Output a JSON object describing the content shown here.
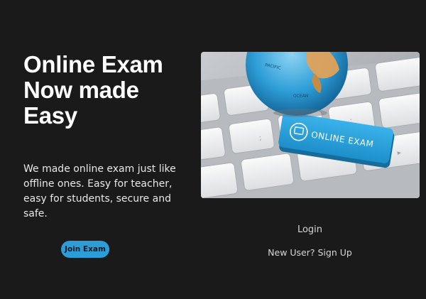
{
  "hero": {
    "title": "Online Exam Now made Easy",
    "description": "We made online exam just like offline ones. Easy for teacher, easy for students, secure and safe.",
    "join_button_label": "Join Exam"
  },
  "image": {
    "key_label": "ONLINE EXAM",
    "globe_text_1": "PACIFIC",
    "globe_text_2": "OCEAN"
  },
  "auth": {
    "login_label": "Login",
    "signup_label": "New User? Sign Up"
  },
  "colors": {
    "background": "#1a1a1a",
    "accent": "#2b9ed8",
    "text": "#ffffff"
  }
}
